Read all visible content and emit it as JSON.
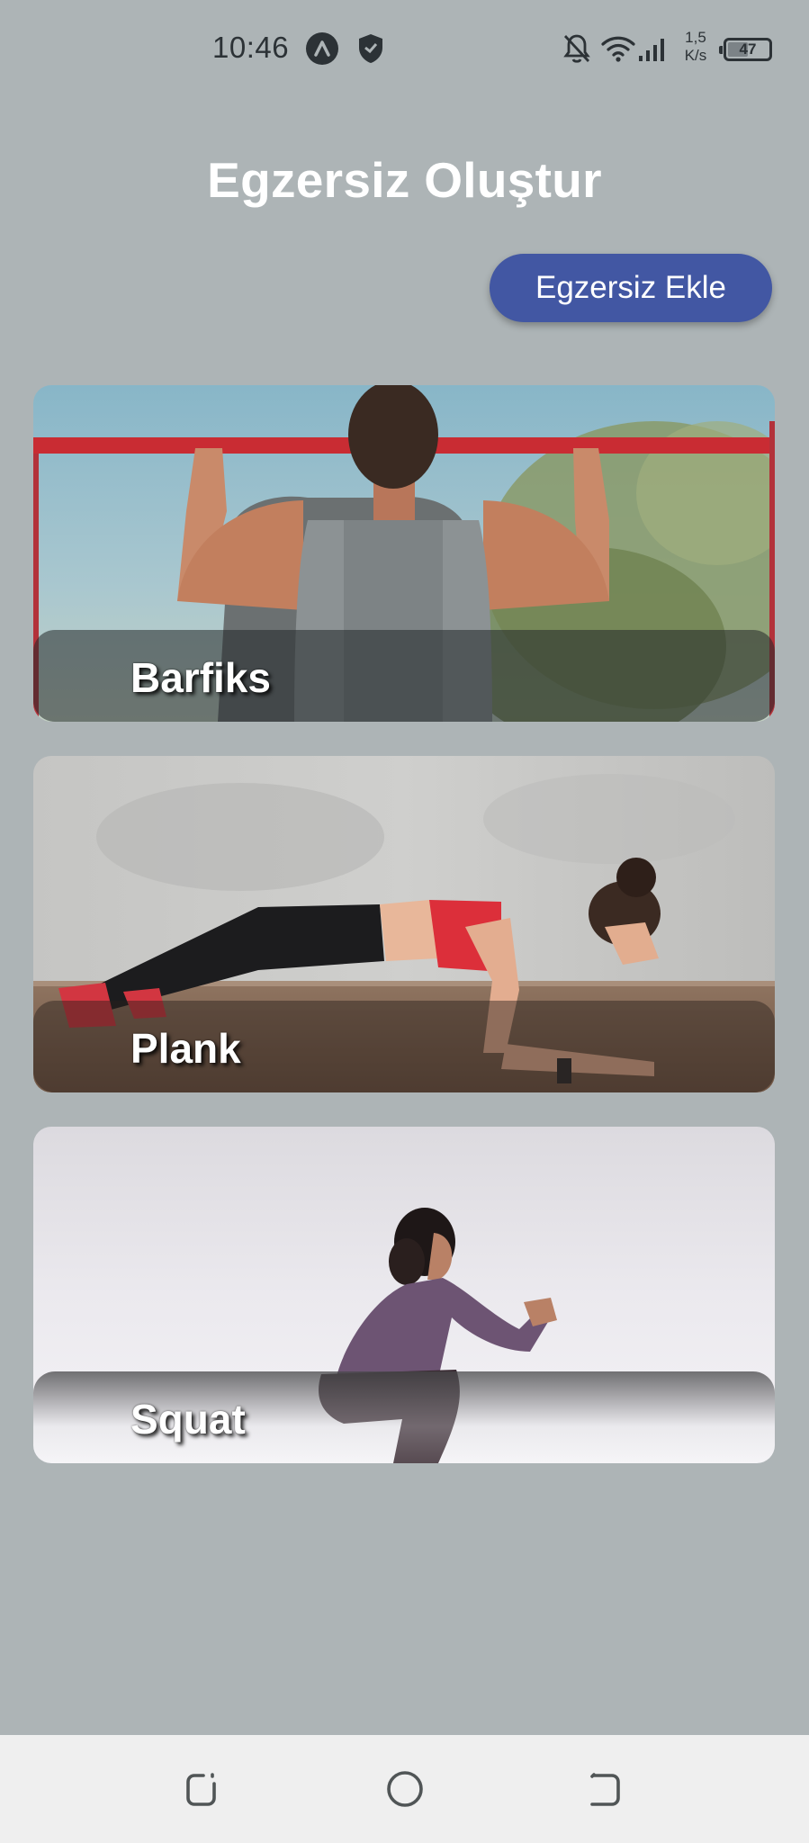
{
  "status_bar": {
    "time": "10:46",
    "net_speed_value": "1,5",
    "net_speed_unit": "K/s",
    "battery": "47",
    "icons": [
      "app-a-icon",
      "shield-icon",
      "bell-off-icon",
      "wifi-icon",
      "signal-icon",
      "battery-icon"
    ]
  },
  "header": {
    "title": "Egzersiz Oluştur",
    "add_button_label": "Egzersiz Ekle"
  },
  "exercises": [
    {
      "name": "Barfiks"
    },
    {
      "name": "Plank"
    },
    {
      "name": "Squat"
    }
  ],
  "nav_bar": {
    "icons": [
      "recent-apps-icon",
      "home-icon",
      "back-icon"
    ]
  },
  "colors": {
    "background": "#adb4b6",
    "accent": "#4257a3",
    "title_text": "#ffffff",
    "nav_background": "#efefef"
  }
}
